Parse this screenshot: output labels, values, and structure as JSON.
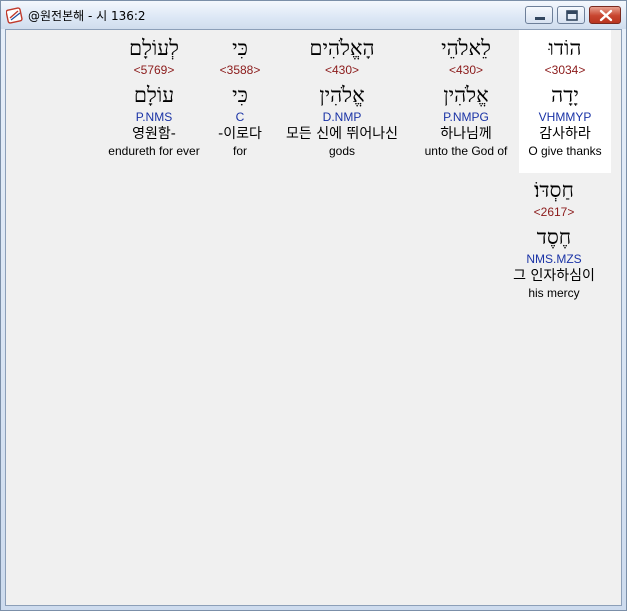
{
  "window": {
    "title": "@원전본해 - 시 136:2",
    "icon": "app-book-icon"
  },
  "words": [
    {
      "hebrew": "הוֹדוּ",
      "strong": "<3034>",
      "lemma": "יָדָה",
      "parsing": "VHMMYP",
      "korean": "감사하라",
      "english": "O give thanks",
      "highlighted": true
    },
    {
      "hebrew": "לֵאלֹהֵי",
      "strong": "<430>",
      "lemma": "אֱלֹהִין",
      "parsing": "P.NMPG",
      "korean": "하나님께",
      "english": "unto the God of",
      "highlighted": false
    },
    {
      "hebrew": "הָאֱלֹהִים",
      "strong": "<430>",
      "lemma": "אֱלֹהִין",
      "parsing": "D.NMP",
      "korean": "모든 신에 뛰어나신",
      "english": "gods",
      "highlighted": false
    },
    {
      "hebrew": "כִּי",
      "strong": "<3588>",
      "lemma": "כִּי",
      "parsing": "C",
      "korean": "-이로다",
      "english": "for",
      "highlighted": false
    },
    {
      "hebrew": "לְעוֹלָם",
      "strong": "<5769>",
      "lemma": "עוֹלָם",
      "parsing": "P.NMS",
      "korean": "영원함-",
      "english": "endureth for ever",
      "highlighted": false
    },
    {
      "hebrew": "חַסְדּוֹ׃",
      "strong": "<2617>",
      "lemma": "חֶסֶד",
      "parsing": "NMS.MZS",
      "korean": "그 인자하심이",
      "english": "his mercy",
      "highlighted": false
    }
  ]
}
